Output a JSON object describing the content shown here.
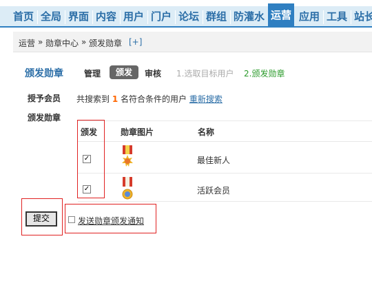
{
  "nav": {
    "items": [
      "首页",
      "全局",
      "界面",
      "内容",
      "用户",
      "门户",
      "论坛",
      "群组",
      "防灌水",
      "运营",
      "应用",
      "工具",
      "站长"
    ],
    "active": "运营"
  },
  "breadcrumb": {
    "items": [
      "运营",
      "勋章中心",
      "颁发勋章"
    ],
    "separator": "»",
    "add": "[+]"
  },
  "title": {
    "heading": "颁发勋章",
    "tab_manage": "管理",
    "tab_award": "颁发",
    "tab_review": "审核",
    "step1": "1.选取目标用户",
    "step2": "2.颁发勋章"
  },
  "form": {
    "grant_member_label": "授予会员",
    "search_prefix": "共搜索到",
    "search_count": "1",
    "search_suffix": "名符合条件的用户",
    "research_link": "重新搜索",
    "award_medal_label": "颁发勋章"
  },
  "table": {
    "headers": [
      "颁发",
      "勋章图片",
      "名称"
    ],
    "rows": [
      {
        "checked": true,
        "medal_icon": "medal-sun-icon",
        "name": "最佳新人"
      },
      {
        "checked": true,
        "medal_icon": "medal-star-icon",
        "name": "活跃会员"
      }
    ]
  },
  "actions": {
    "submit": "提交",
    "notify_label": "发送勋章颁发通知",
    "notify_checked": false
  },
  "colors": {
    "nav_active": "#2f7fc1",
    "link": "#2b6ea7",
    "annotation": "#e02020",
    "count": "#ff6600",
    "step_done": "#2a9a2a"
  }
}
